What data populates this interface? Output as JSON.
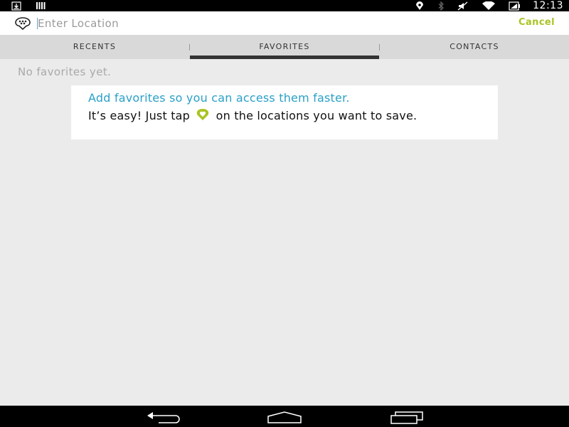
{
  "status_bar": {
    "time": "12:13",
    "left_icons": [
      "download-icon",
      "signal-bars-icon"
    ],
    "right_icons": [
      "location-icon",
      "bluetooth-icon",
      "mute-icon",
      "wifi-icon",
      "battery-icon"
    ]
  },
  "search": {
    "placeholder": "Enter Location",
    "cancel_label": "Cancel"
  },
  "tabs": [
    {
      "label": "RECENTS",
      "active": false
    },
    {
      "label": "FAVORITES",
      "active": true
    },
    {
      "label": "CONTACTS",
      "active": false
    }
  ],
  "favorites": {
    "empty_message": "No favorites yet.",
    "hint_title": "Add favorites so you can access them faster.",
    "hint_body_before": "It’s easy! Just tap",
    "hint_body_after": "on the locations you want to save."
  },
  "nav_bar": {
    "buttons": [
      "back-icon",
      "home-icon",
      "recent-apps-icon"
    ]
  },
  "colors": {
    "accent_green": "#a8c424",
    "accent_blue": "#2aa0c8",
    "tab_bar_bg": "#d9d9d9",
    "page_bg": "#ebebeb"
  }
}
